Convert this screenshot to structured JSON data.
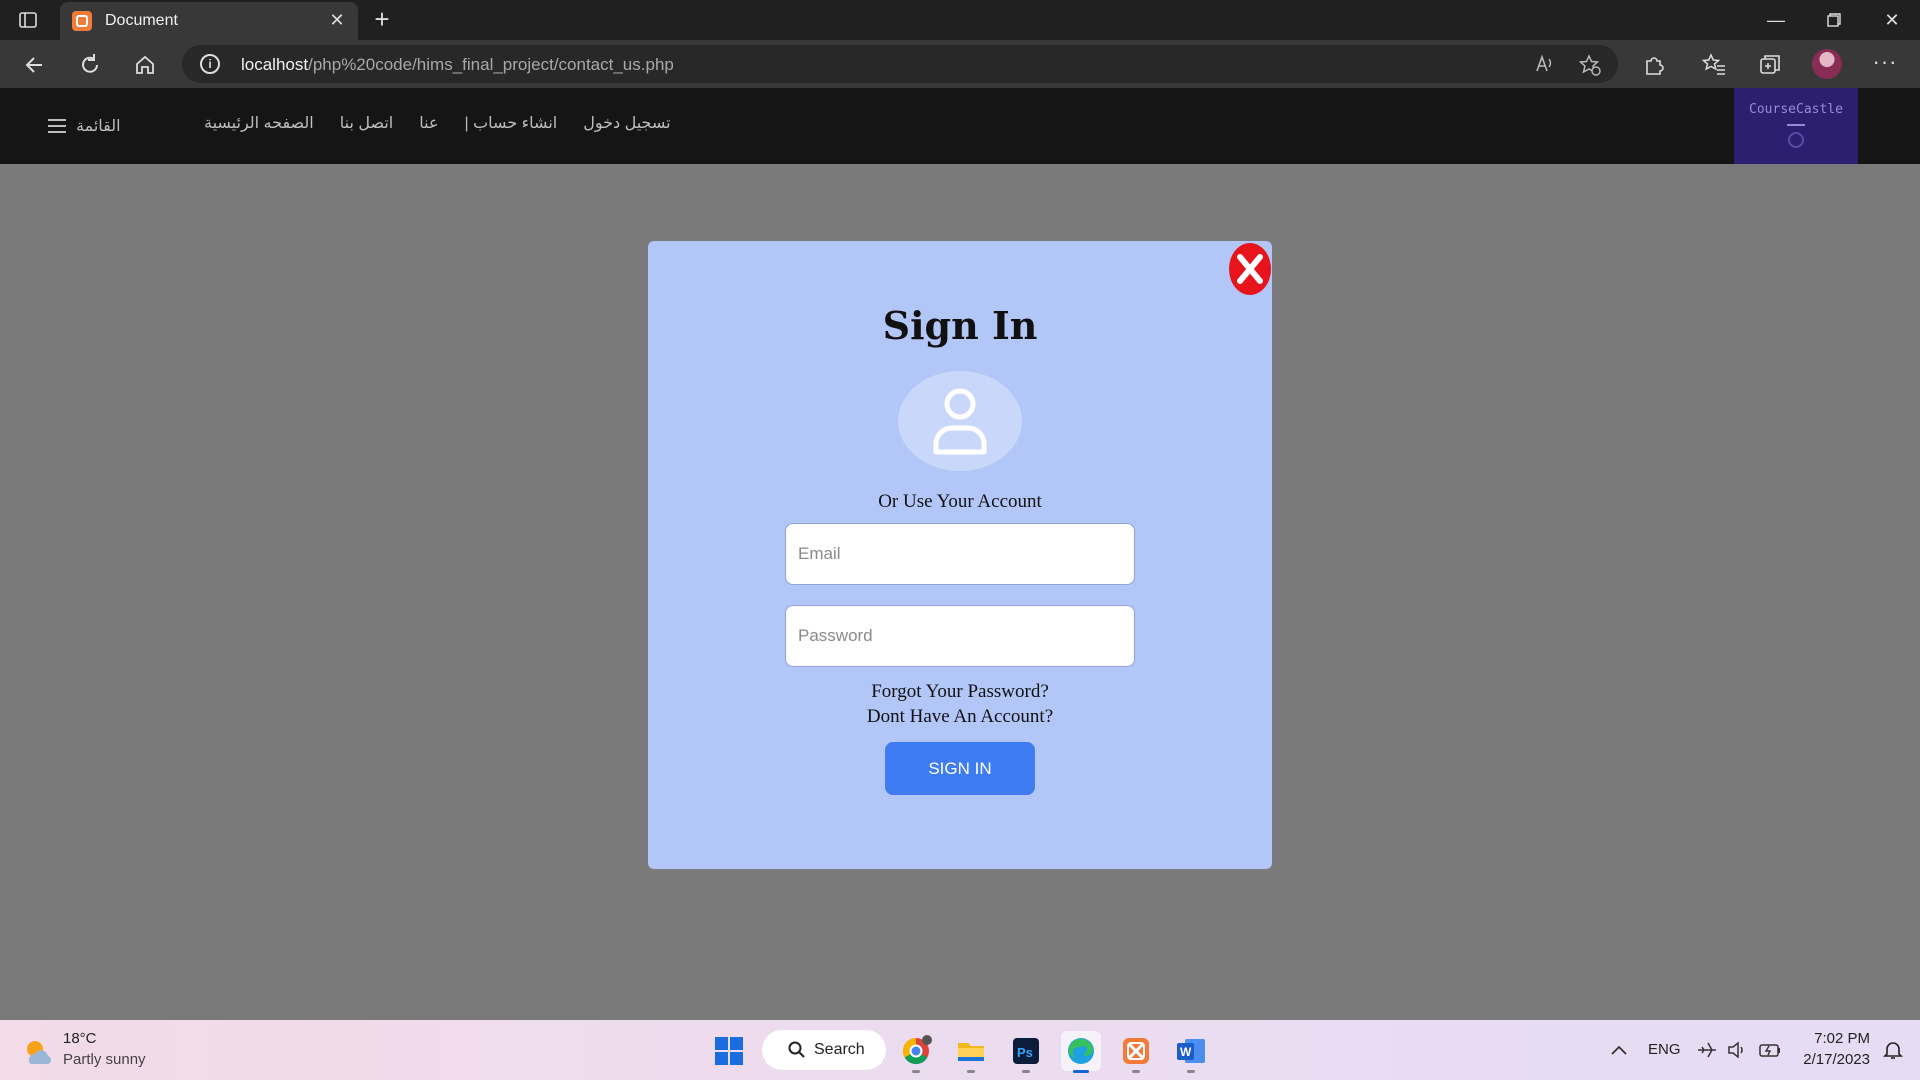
{
  "browser": {
    "tab_title": "Document",
    "url_host": "localhost",
    "url_path": "/php%20code/hims_final_project/contact_us.php"
  },
  "site": {
    "menu_label": "القائمة",
    "nav_links": [
      "الصفحه الرئيسية",
      "اتصل بنا",
      "عنا",
      "انشاء حساب |",
      "تسجيل دخول"
    ],
    "brand_name": "CourseCastle"
  },
  "modal": {
    "title": "Sign In",
    "alt_text": "Or Use Your Account",
    "email_placeholder": "Email",
    "password_placeholder": "Password",
    "forgot_link": "Forgot Your Password?",
    "no_account_link": "Dont Have An Account?",
    "submit_label": "SIGN IN"
  },
  "taskbar": {
    "weather_temp": "18°C",
    "weather_desc": "Partly sunny",
    "search_label": "Search",
    "language": "ENG",
    "time": "7:02 PM",
    "date": "2/17/2023"
  },
  "colors": {
    "modal_bg": "#b2c6f8",
    "button_bg": "#3e7cf4",
    "close_red": "#e8141c",
    "header_bg": "#151515",
    "overlay_bg": "#7a7a7a"
  }
}
